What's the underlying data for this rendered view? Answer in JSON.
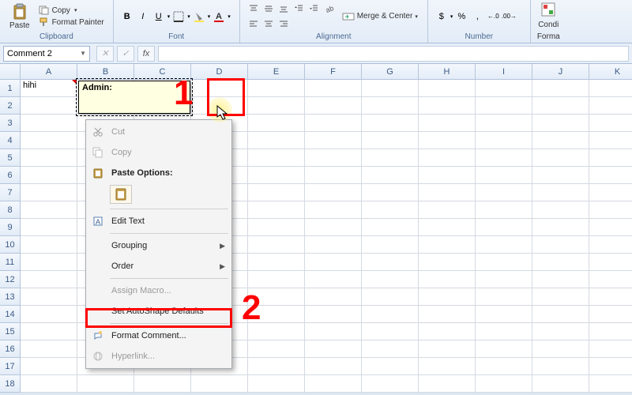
{
  "ribbon": {
    "paste_label": "Paste",
    "copy_label": "Copy",
    "format_painter_label": "Format Painter",
    "clipboard_group": "Clipboard",
    "font_group": "Font",
    "alignment_group": "Alignment",
    "number_group": "Number",
    "merge_label": "Merge & Center",
    "cond_fmt": "Condi",
    "cond_fmt2": "Forma",
    "currency": "$",
    "percent": "%",
    "comma": ",",
    "dec_inc": ".0",
    "dec_dec": ".00",
    "bold": "B",
    "italic": "I",
    "underline": "U"
  },
  "formula_bar": {
    "name_box_value": "Comment 2",
    "fx": "fx"
  },
  "columns": [
    "A",
    "B",
    "C",
    "D",
    "E",
    "F",
    "G",
    "H",
    "I",
    "J",
    "K"
  ],
  "rows": [
    "1",
    "2",
    "3",
    "4",
    "5",
    "6",
    "7",
    "8",
    "9",
    "10",
    "11",
    "12",
    "13",
    "14",
    "15",
    "16",
    "17",
    "18"
  ],
  "cells": {
    "a1": "hihi"
  },
  "comment": {
    "author": "Admin:"
  },
  "context_menu": {
    "cut": "Cut",
    "copy": "Copy",
    "paste_options": "Paste Options:",
    "edit_text": "Edit Text",
    "grouping": "Grouping",
    "order": "Order",
    "assign_macro": "Assign Macro...",
    "set_autoshape": "Set AutoShape Defaults",
    "format_comment": "Format Comment...",
    "hyperlink": "Hyperlink..."
  },
  "annotations": {
    "one": "1",
    "two": "2"
  }
}
